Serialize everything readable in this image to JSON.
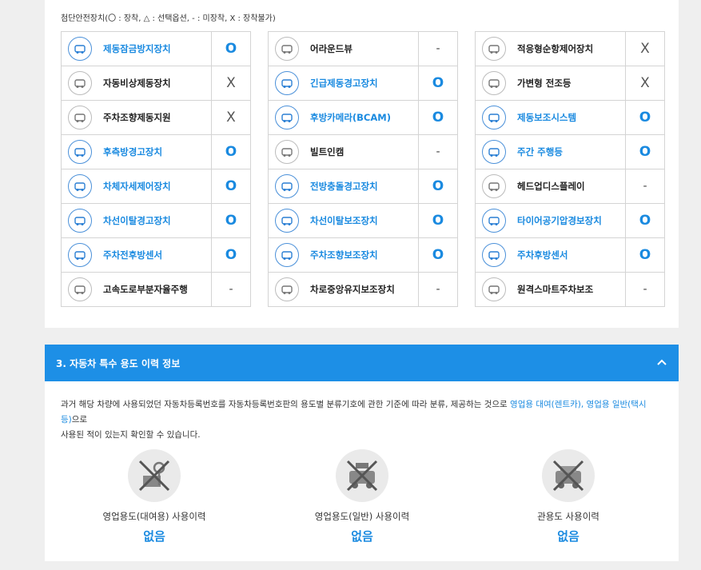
{
  "legend": "첨단안전장치(〇 : 장착, △ : 선택옵션, - : 미장착, X : 장착불가)",
  "columns": [
    [
      {
        "name": "제동잠금방지장치",
        "value": "O",
        "icon": "abs-icon",
        "highlight": true
      },
      {
        "name": "자동비상제동장치",
        "value": "X",
        "icon": "emergency-brake-icon",
        "highlight": false
      },
      {
        "name": "주차조향제동지원",
        "value": "X",
        "icon": "steering-brake-icon",
        "highlight": false
      },
      {
        "name": "후측방경고장치",
        "value": "O",
        "icon": "rear-side-warning-icon",
        "highlight": true
      },
      {
        "name": "차체자세제어장치",
        "value": "O",
        "icon": "stability-control-icon",
        "highlight": true
      },
      {
        "name": "차선이탈경고장치",
        "value": "O",
        "icon": "lane-departure-icon",
        "highlight": true
      },
      {
        "name": "주차전후방센서",
        "value": "O",
        "icon": "parking-sensor-icon",
        "highlight": true
      },
      {
        "name": "고속도로부분자율주행",
        "value": "-",
        "icon": "highway-assist-icon",
        "highlight": false
      }
    ],
    [
      {
        "name": "어라운드뷰",
        "value": "-",
        "icon": "around-view-icon",
        "highlight": false
      },
      {
        "name": "긴급제동경고장치",
        "value": "O",
        "icon": "brake-warning-icon",
        "highlight": true
      },
      {
        "name": "후방카메라(BCAM)",
        "value": "O",
        "icon": "rear-camera-icon",
        "highlight": true
      },
      {
        "name": "빌트인캠",
        "value": "-",
        "icon": "builtin-cam-icon",
        "highlight": false
      },
      {
        "name": "전방충돌경고장치",
        "value": "O",
        "icon": "forward-collision-icon",
        "highlight": true
      },
      {
        "name": "차선이탈보조장치",
        "value": "O",
        "icon": "lane-keep-icon",
        "highlight": true
      },
      {
        "name": "주차조향보조장치",
        "value": "O",
        "icon": "parking-steering-icon",
        "highlight": true
      },
      {
        "name": "차로중앙유지보조장치",
        "value": "-",
        "icon": "lane-center-icon",
        "highlight": false
      }
    ],
    [
      {
        "name": "적응형순항제어장치",
        "value": "X",
        "icon": "adaptive-cruise-icon",
        "highlight": false
      },
      {
        "name": "가변형 전조등",
        "value": "X",
        "icon": "adaptive-headlight-icon",
        "highlight": false
      },
      {
        "name": "제동보조시스템",
        "value": "O",
        "icon": "brake-assist-icon",
        "highlight": true
      },
      {
        "name": "주간 주행등",
        "value": "O",
        "icon": "daytime-light-icon",
        "highlight": true
      },
      {
        "name": "헤드업디스플레이",
        "value": "-",
        "icon": "hud-icon",
        "highlight": false
      },
      {
        "name": "타이어공기압경보장치",
        "value": "O",
        "icon": "tpms-icon",
        "highlight": true
      },
      {
        "name": "주차후방센서",
        "value": "O",
        "icon": "rear-parking-sensor-icon",
        "highlight": true
      },
      {
        "name": "원격스마트주차보조",
        "value": "-",
        "icon": "remote-parking-icon",
        "highlight": false
      }
    ]
  ],
  "section3": {
    "title": "3. 자동차 특수 용도 이력 정보",
    "desc_part1": "과거 해당 차량에 사용되었던 자동차등록번호를 자동차등록번호판의 용도별 분류기호에 관한 기준에 따라 분류, 제공하는 것으로 ",
    "desc_highlight": "영업용 대여(렌트카), 영업용 일반(택시 등)",
    "desc_part2": "으로",
    "desc_line2": "사용된 적이 있는지 확인할 수 있습니다.",
    "items": [
      {
        "label": "영업용도(대여용) 사용이력",
        "value": "없음",
        "icon": "rental-none-icon"
      },
      {
        "label": "영업용도(일반) 사용이력",
        "value": "없음",
        "icon": "taxi-none-icon"
      },
      {
        "label": "관용도 사용이력",
        "value": "없음",
        "icon": "government-none-icon"
      }
    ]
  },
  "colors": {
    "accent": "#1d8fe6",
    "highlight_text": "#1a8ae0"
  }
}
